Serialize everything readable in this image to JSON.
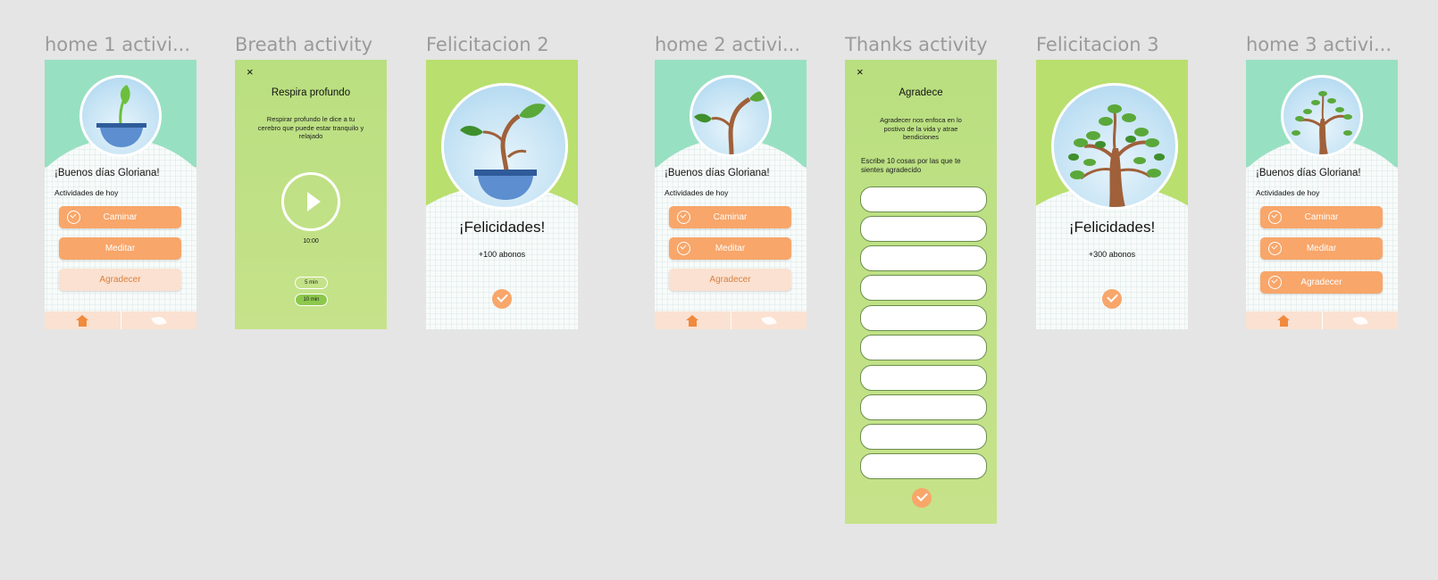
{
  "frames": {
    "home1": {
      "title": "home 1 activi...",
      "greeting": "¡Buenos días Gloriana!",
      "subtitle": "Actividades de hoy",
      "buttons": [
        "Caminar",
        "Meditar",
        "Agradecer"
      ]
    },
    "breath": {
      "title": "Breath activity",
      "close": "×",
      "heading": "Respira profundo",
      "description": "Respirar profundo le dice a tu cerebro que puede estar tranquilo y relajado",
      "timer": "10:00",
      "options": [
        "5 min",
        "10 min"
      ]
    },
    "fel2": {
      "title": "Felicitacion 2",
      "message": "¡Felicidades!",
      "points": "+100 abonos"
    },
    "home2": {
      "title": "home 2 activi...",
      "greeting": "¡Buenos días Gloriana!",
      "subtitle": "Actividades de hoy",
      "buttons": [
        "Caminar",
        "Meditar",
        "Agradecer"
      ]
    },
    "thanks": {
      "title": "Thanks activity",
      "close": "×",
      "heading": "Agradece",
      "description": "Agradecer nos enfoca en lo postivo de la vida y atrae bendiciones",
      "instruction": "Escribe 10 cosas por las que te sientes agradecido",
      "fields": [
        "",
        "",
        "",
        "",
        "",
        "",
        "",
        "",
        "",
        ""
      ]
    },
    "fel3": {
      "title": "Felicitacion 3",
      "message": "¡Felicidades!",
      "points": "+300 abonos"
    },
    "home3": {
      "title": "home 3 activi...",
      "greeting": "¡Buenos días Gloriana!",
      "subtitle": "Actividades de hoy",
      "buttons": [
        "Caminar",
        "Meditar",
        "Agradecer"
      ]
    }
  },
  "colors": {
    "canvas": "#e5e5e5",
    "mint": "#98e0c2",
    "lime": "#b9df6e",
    "orange": "#f8a66a",
    "orange_light": "#fbe1d1"
  },
  "icons": [
    "home-icon",
    "leaf-icon",
    "check-icon",
    "play-icon",
    "close-icon"
  ]
}
